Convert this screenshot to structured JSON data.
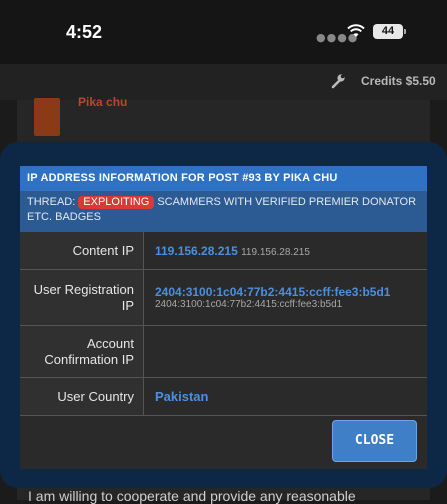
{
  "status_bar": {
    "time": "4:52",
    "battery": "44"
  },
  "nav": {
    "credits": "Credits $5.50"
  },
  "background": {
    "author": "Pika chu",
    "body_text": "I am willing to cooperate and provide any reasonable"
  },
  "dialog": {
    "title": "IP ADDRESS INFORMATION FOR POST #93 BY PIKA CHU",
    "thread_prefix": "THREAD:",
    "thread_badge": "EXPLOITING",
    "thread_title": "SCAMMERS WITH VERIFIED PREMIER DONATOR ETC. BADGES",
    "rows": [
      {
        "label": "Content IP",
        "value": "119.156.28.215",
        "sub": "119.156.28.215"
      },
      {
        "label": "User Registration IP",
        "value": "2404:3100:1c04:77b2:4415:ccff:fee3:b5d1",
        "sub": "2404:3100:1c04:77b2:4415:ccff:fee3:b5d1"
      },
      {
        "label": "Account Confirmation IP",
        "value": "",
        "sub": ""
      },
      {
        "label": "User Country",
        "value": "Pakistan"
      }
    ],
    "close_label": "CLOSE"
  },
  "colors": {
    "accent": "#2f72c4",
    "link": "#4a90e2",
    "badge": "#d83a34"
  },
  "icons": [
    "wifi-icon",
    "battery-icon",
    "wrench-icon",
    "signal-dots-icon"
  ]
}
